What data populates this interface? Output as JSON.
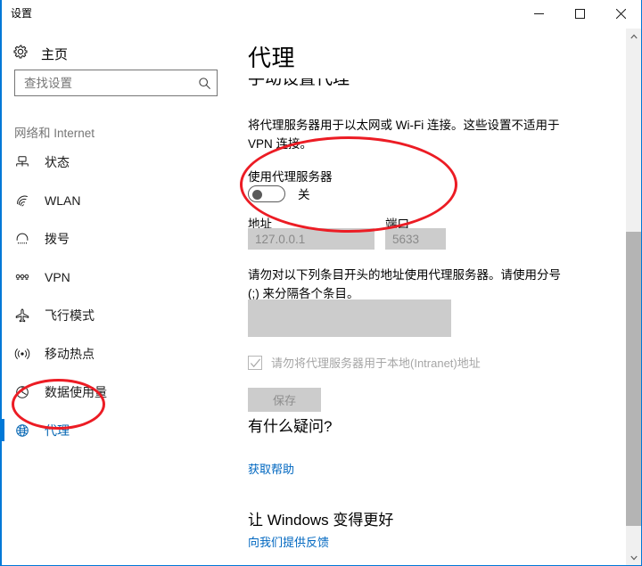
{
  "window": {
    "caption": "设置",
    "buttons": {
      "minimize": "minimize-icon",
      "maximize": "maximize-icon",
      "close": "close-icon"
    }
  },
  "sidebar": {
    "home": {
      "label": "主页",
      "icon": "gear-icon"
    },
    "search": {
      "placeholder": "查找设置",
      "value": "",
      "icon": "search-icon"
    },
    "group_header": "网络和 Internet",
    "items": [
      {
        "label": "状态",
        "icon": "network-status-icon",
        "selected": false
      },
      {
        "label": "WLAN",
        "icon": "wifi-icon",
        "selected": false
      },
      {
        "label": "拨号",
        "icon": "dialup-icon",
        "selected": false
      },
      {
        "label": "VPN",
        "icon": "vpn-icon",
        "selected": false
      },
      {
        "label": "飞行模式",
        "icon": "airplane-icon",
        "selected": false
      },
      {
        "label": "移动热点",
        "icon": "hotspot-icon",
        "selected": false
      },
      {
        "label": "数据使用量",
        "icon": "data-usage-icon",
        "selected": false
      },
      {
        "label": "代理",
        "icon": "globe-icon",
        "selected": true
      }
    ]
  },
  "content": {
    "page_title": "代理",
    "clipped_heading": "手动设置代理",
    "description": "将代理服务器用于以太网或 Wi-Fi 连接。这些设置不适用于 VPN 连接。",
    "use_proxy_label": "使用代理服务器",
    "toggle_state": "关",
    "address_label": "地址",
    "address_value": "127.0.0.1",
    "port_label": "端口",
    "port_value": "5633",
    "bypass_description": "请勿对以下列条目开头的地址使用代理服务器。请使用分号 (;) 来分隔各个条目。",
    "bypass_value": "",
    "local_bypass_label": "请勿将代理服务器用于本地(Intranet)地址",
    "local_bypass_checked": true,
    "save_label": "保存",
    "help_title": "有什么疑问?",
    "help_link": "获取帮助",
    "feedback_title": "让 Windows 变得更好",
    "feedback_link": "向我们提供反馈"
  },
  "scrollbar": {
    "up_icon": "chevron-up-icon",
    "down_icon": "chevron-down-icon"
  },
  "annotations": {
    "accent_color": "#ec1c24",
    "items": [
      {
        "name": "sidebar-proxy-highlight",
        "shape": "ellipse"
      },
      {
        "name": "proxy-server-settings-highlight",
        "shape": "ellipse"
      }
    ]
  },
  "colors": {
    "accent": "#0078d7",
    "selected_text": "#0063b1",
    "link": "#0067c0",
    "disabled_field_bg": "#cccccc",
    "annotation": "#ec1c24"
  }
}
